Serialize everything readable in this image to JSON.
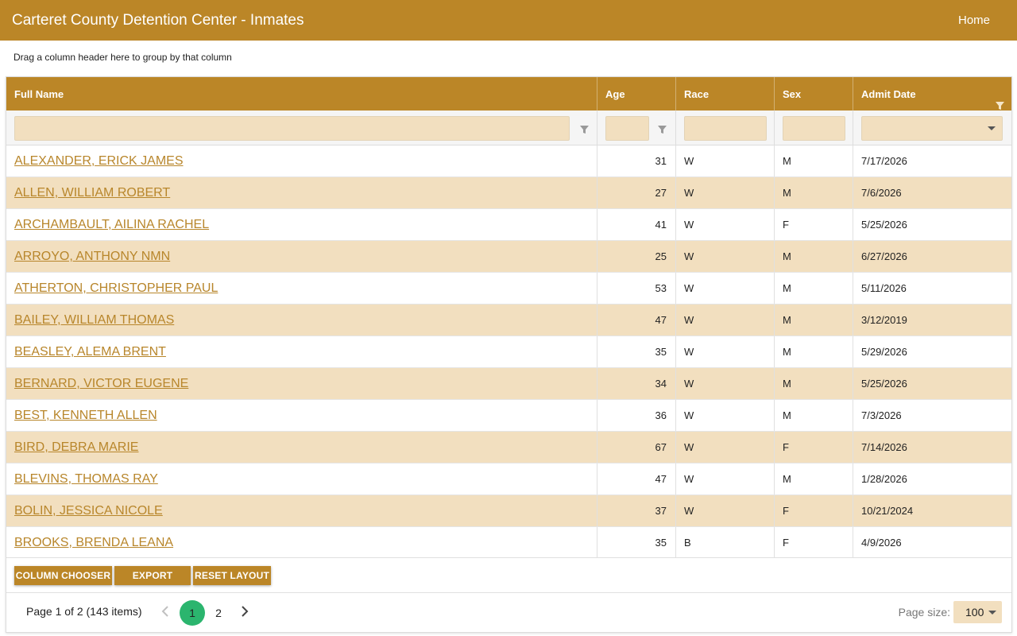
{
  "app": {
    "title": "Carteret County Detention Center - Inmates",
    "home_label": "Home"
  },
  "grid": {
    "group_hint": "Drag a column header here to group by that column",
    "columns": [
      "Full Name",
      "Age",
      "Race",
      "Sex",
      "Admit Date"
    ],
    "rows": [
      {
        "name": "ALEXANDER, ERICK JAMES",
        "age": "31",
        "race": "W",
        "sex": "M",
        "admit": "7/17/2026"
      },
      {
        "name": "ALLEN, WILLIAM ROBERT",
        "age": "27",
        "race": "W",
        "sex": "M",
        "admit": "7/6/2026"
      },
      {
        "name": "ARCHAMBAULT, AILINA RACHEL",
        "age": "41",
        "race": "W",
        "sex": "F",
        "admit": "5/25/2026"
      },
      {
        "name": "ARROYO, ANTHONY NMN",
        "age": "25",
        "race": "W",
        "sex": "M",
        "admit": "6/27/2026"
      },
      {
        "name": "ATHERTON, CHRISTOPHER PAUL",
        "age": "53",
        "race": "W",
        "sex": "M",
        "admit": "5/11/2026"
      },
      {
        "name": "BAILEY, WILLIAM THOMAS",
        "age": "47",
        "race": "W",
        "sex": "M",
        "admit": "3/12/2019"
      },
      {
        "name": "BEASLEY, ALEMA BRENT",
        "age": "35",
        "race": "W",
        "sex": "M",
        "admit": "5/29/2026"
      },
      {
        "name": "BERNARD, VICTOR EUGENE",
        "age": "34",
        "race": "W",
        "sex": "M",
        "admit": "5/25/2026"
      },
      {
        "name": "BEST, KENNETH ALLEN",
        "age": "36",
        "race": "W",
        "sex": "M",
        "admit": "7/3/2026"
      },
      {
        "name": "BIRD, DEBRA MARIE",
        "age": "67",
        "race": "W",
        "sex": "F",
        "admit": "7/14/2026"
      },
      {
        "name": "BLEVINS, THOMAS RAY",
        "age": "47",
        "race": "W",
        "sex": "M",
        "admit": "1/28/2026"
      },
      {
        "name": "BOLIN, JESSICA NICOLE",
        "age": "37",
        "race": "W",
        "sex": "F",
        "admit": "10/21/2024"
      },
      {
        "name": "BROOKS, BRENDA LEANA",
        "age": "35",
        "race": "B",
        "sex": "F",
        "admit": "4/9/2026"
      }
    ]
  },
  "toolbar": {
    "column_chooser": "COLUMN CHOOSER",
    "export": "EXPORT",
    "reset_layout": "RESET LAYOUT"
  },
  "pager": {
    "info": "Page 1 of 2 (143 items)",
    "pages": [
      "1",
      "2"
    ],
    "current_page": "1",
    "page_size_label": "Page size:",
    "page_size": "100"
  },
  "icons": {
    "filter": "funnel-icon",
    "prev": "chevron-left-icon",
    "next": "chevron-right-icon",
    "dropdown": "caret-down-icon"
  },
  "colors": {
    "brand": "#bb8627",
    "row_alt": "#f2dfbf",
    "link": "#b8862b",
    "active_page": "#2bb56e"
  }
}
